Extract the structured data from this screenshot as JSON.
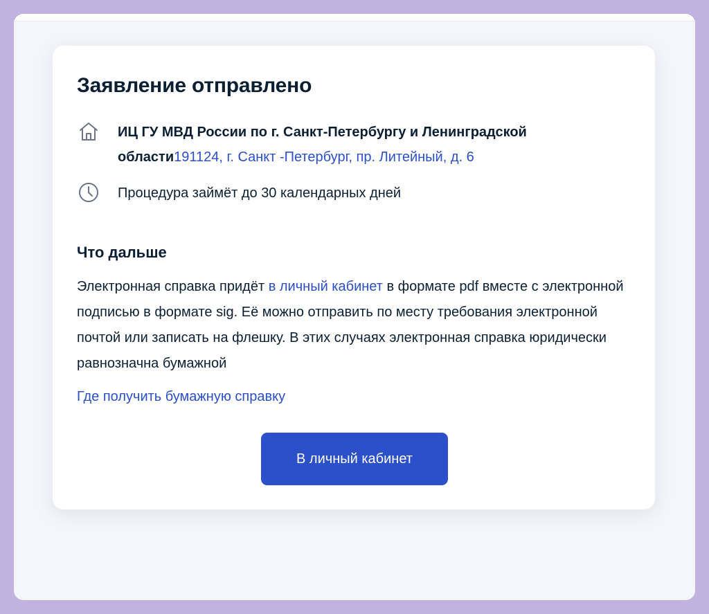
{
  "page": {
    "title": "Заявление отправлено"
  },
  "organization": {
    "icon": "building-icon",
    "name": "ИЦ ГУ МВД России по г. Санкт-Петербургу и Ленинградской области",
    "address": "191124, г. Санкт -Петербург, пр. Литейный, д. 6"
  },
  "duration": {
    "icon": "clock-icon",
    "text": "Процедура займёт до 30 календарных дней"
  },
  "next_steps": {
    "heading": "Что дальше",
    "text_before_link": "Электронная справка придёт ",
    "link_label": "в личный кабинет",
    "text_after_link": " в формате pdf вместе с электронной подписью в формате sig. Её можно отправить по месту требования электронной почтой или записать на флешку. В этих случаях электронная справка юридически равнозначна бумажной",
    "paper_link_label": "Где получить бумажную справку"
  },
  "actions": {
    "cabinet_button_label": "В личный кабинет"
  },
  "colors": {
    "accent": "#2c4fca",
    "link": "#2b4fc8",
    "text": "#0b1f33",
    "frame": "#c0b3e0",
    "page_background": "#f5f6fb",
    "card": "#ffffff"
  }
}
